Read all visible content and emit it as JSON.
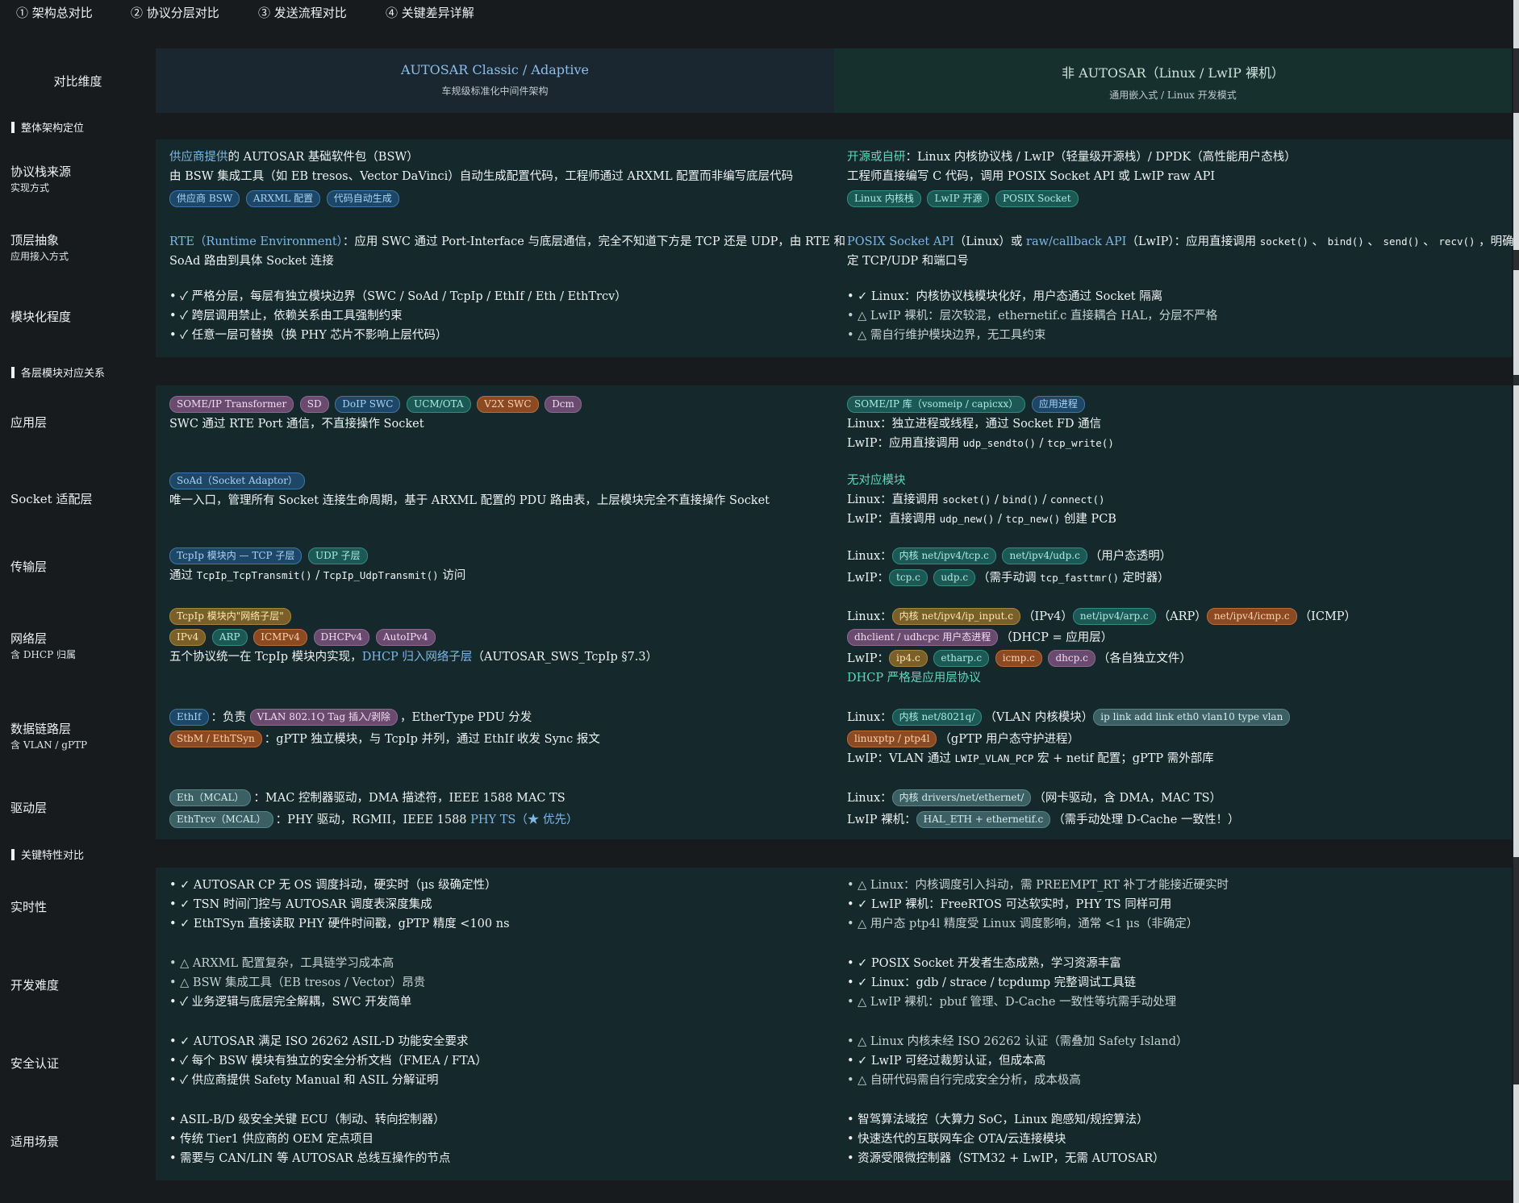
{
  "tabs": [
    "① 架构总对比",
    "② 协议分层对比",
    "③ 发送流程对比",
    "④ 关键差异详解"
  ],
  "header": {
    "dim_label": "对比维度",
    "colA_title": "AUTOSAR Classic / Adaptive",
    "colA_sub": "车规级标准化中间件架构",
    "colB_title": "非 AUTOSAR（Linux / LwIP 裸机）",
    "colB_sub": "通用嵌入式 / Linux 开发模式"
  },
  "sections": {
    "s1": "整体架构定位",
    "s2": "各层模块对应关系",
    "s3": "关键特性对比"
  },
  "rows": {
    "stack": {
      "label": "协议栈来源",
      "sub": "实现方式",
      "a_hl": "供应商提供",
      "a1_rest": "的 AUTOSAR 基础软件包（BSW）",
      "a2": "由 BSW 集成工具（如 EB tresos、Vector DaVinci）自动生成配置代码，工程师通过 ARXML 配置而非编写底层代码",
      "a_tags": [
        "供应商 BSW",
        "ARXML 配置",
        "代码自动生成"
      ],
      "b_hl": "开源或自研",
      "b1_rest": "：Linux 内核协议栈 / LwIP（轻量级开源栈）/ DPDK（高性能用户态栈）",
      "b2": "工程师直接编写 C 代码，调用 POSIX Socket API 或 LwIP raw API",
      "b_tags": [
        "Linux 内核栈",
        "LwIP 开源",
        "POSIX Socket"
      ]
    },
    "abstract": {
      "label": "顶层抽象",
      "sub": "应用接入方式",
      "a_hl": "RTE（Runtime Environment）",
      "a1_rest": "：应用 SWC 通过 Port-Interface 与底层通信，完全不知道下方是 TCP 还是 UDP，由 RTE 和",
      "a2": "SoAd 路由到具体 Socket 连接",
      "b_hl1": "POSIX Socket API",
      "b_m1": "（Linux）或 ",
      "b_hl2": "raw/callback API",
      "b_m2": "（LwIP）：应用直接调用 ",
      "b_c1": "socket()",
      "b_c2": "bind()",
      "b_c3": "send()",
      "b_c4": "recv()",
      "b_sep": " 、 ",
      "b_m3": " ，明确指",
      "b2": "定 TCP/UDP 和端口号"
    },
    "modular": {
      "label": "模块化程度",
      "a": [
        "✓ 严格分层，每层有独立模块边界（SWC / SoAd / TcpIp / EthIf / Eth / EthTrcv）",
        "✓ 跨层调用禁止，依赖关系由工具强制约束",
        "✓ 任意一层可替换（换 PHY 芯片不影响上层代码）"
      ],
      "b": [
        "✓ Linux：内核协议栈模块化好，用户态通过 Socket 隔离",
        "△ LwIP 裸机：层次较混，ethernetif.c 直接耦合 HAL，分层不严格",
        "△ 需自行维护模块边界，无工具约束"
      ]
    },
    "app": {
      "label": "应用层",
      "a_tags": [
        "SOME/IP Transformer",
        "SD",
        "DoIP SWC",
        "UCM/OTA",
        "V2X SWC",
        "Dcm"
      ],
      "a1": "SWC 通过 RTE Port 通信，不直接操作 Socket",
      "b_tags": [
        "SOME/IP 库（vsomeip / capicxx）",
        "应用进程"
      ],
      "b1": "Linux：独立进程或线程，通过 Socket FD 通信",
      "b2_pre": "LwIP：应用直接调用 ",
      "b2_c1": "udp_sendto()",
      "b2_sep": " / ",
      "b2_c2": "tcp_write()"
    },
    "socket": {
      "label": "Socket 适配层",
      "a_tag": "SoAd（Socket Adaptor）",
      "a1": "唯一入口，管理所有 Socket 连接生命周期，基于 ARXML 配置的 PDU 路由表，上层模块完全不直接操作 Socket",
      "b_hl": "无对应模块",
      "b1_pre": "Linux：直接调用 ",
      "b1_c1": "socket()",
      "b1_c2": "bind()",
      "b1_c3": "connect()",
      "b_sep": " / ",
      "b2_pre": "LwIP：直接调用 ",
      "b2_c1": "udp_new()",
      "b2_c2": "tcp_new()",
      "b2_post": " 创建 PCB"
    },
    "transport": {
      "label": "传输层",
      "a_tags": [
        "TcpIp 模块内 — TCP 子层",
        "UDP 子层"
      ],
      "a1_pre": "通过 ",
      "a1_c1": "TcpIp_TcpTransmit()",
      "a1_sep": " / ",
      "a1_c2": "TcpIp_UdpTransmit()",
      "a1_post": " 访问",
      "b1_pre": "Linux：",
      "b1_tags": [
        "内核 net/ipv4/tcp.c",
        "net/ipv4/udp.c"
      ],
      "b1_post": "（用户态透明）",
      "b2_pre": "LwIP：",
      "b2_tags": [
        "tcp.c",
        "udp.c"
      ],
      "b2_mid": "（需手动调 ",
      "b2_c": "tcp_fasttmr()",
      "b2_post": " 定时器）"
    },
    "network": {
      "label": "网络层",
      "sub": "含 DHCP 归属",
      "a_tag_top": "TcpIp 模块内\"网络子层\"",
      "a_tags": [
        "IPv4",
        "ARP",
        "ICMPv4",
        "DHCPv4",
        "AutoIPv4"
      ],
      "a1_pre": "五个协议统一在 TcpIp 模块内实现，",
      "a1_hl": "DHCP 归入网络子层",
      "a1_post": "（AUTOSAR_SWS_TcpIp §7.3）",
      "b1_pre": "Linux：",
      "b1_t1": "内核 net/ipv4/ip_input.c",
      "b1_m1": "（IPv4）",
      "b1_t2": "net/ipv4/arp.c",
      "b1_m2": "（ARP）",
      "b1_t3": "net/ipv4/icmp.c",
      "b1_m3": "（ICMP）",
      "b2_tag": "dhclient / udhcpc 用户态进程",
      "b2_post": "（DHCP = 应用层）",
      "b3_pre": "LwIP：",
      "b3_tags": [
        "ip4.c",
        "etharp.c",
        "icmp.c",
        "dhcp.c"
      ],
      "b3_post": "（各自独立文件）",
      "b4_hl": "DHCP 严格是应用层协议"
    },
    "datalink": {
      "label": "数据链路层",
      "sub": "含 VLAN / gPTP",
      "a1_tag": "EthIf",
      "a1_mid": "：负责 ",
      "a1_tag2": "VLAN 802.1Q Tag 插入/剥除",
      "a1_post": "，EtherType PDU 分发",
      "a2_tag": "StbM / EthTSyn",
      "a2_post": "：gPTP 独立模块，与 TcpIp 并列，通过 EthIf 收发 Sync 报文",
      "b1_pre": "Linux：",
      "b1_tag": "内核 net/8021q/",
      "b1_mid": "（VLAN 内核模块）",
      "b1_tag2": "ip link add link eth0 vlan10 type vlan",
      "b2_tag": "linuxptp / ptp4l",
      "b2_post": "（gPTP 用户态守护进程）",
      "b3_pre": "LwIP：VLAN 通过 ",
      "b3_c": "LWIP_VLAN_PCP",
      "b3_post": " 宏 + netif 配置；gPTP 需外部库"
    },
    "driver": {
      "label": "驱动层",
      "a1_tag": "Eth（MCAL）",
      "a1_post": "：MAC 控制器驱动，DMA 描述符，IEEE 1588 MAC TS",
      "a2_tag": "EthTrcv（MCAL）",
      "a2_mid": "：PHY 驱动，RGMII，IEEE 1588 ",
      "a2_hl": "PHY TS（★ 优先）",
      "b1_pre": "Linux：",
      "b1_tag": "内核 drivers/net/ethernet/",
      "b1_post": "（网卡驱动，含 DMA，MAC TS）",
      "b2_pre": "LwIP 裸机：",
      "b2_tag": "HAL_ETH + ethernetif.c",
      "b2_post": "（需手动处理 D-Cache 一致性！）"
    },
    "realtime": {
      "label": "实时性",
      "a": [
        "✓ AUTOSAR CP 无 OS 调度抖动，硬实时（μs 级确定性）",
        "✓ TSN 时间门控与 AUTOSAR 调度表深度集成",
        "✓ EthTSyn 直接读取 PHY 硬件时间戳，gPTP 精度 <100 ns"
      ],
      "b": [
        "△ Linux：内核调度引入抖动，需 PREEMPT_RT 补丁才能接近硬实时",
        "✓ LwIP 裸机：FreeRTOS 可达软实时，PHY TS 同样可用",
        "△ 用户态 ptp4l 精度受 Linux 调度影响，通常 <1 μs（非确定）"
      ]
    },
    "difficulty": {
      "label": "开发难度",
      "a": [
        "△ ARXML 配置复杂，工具链学习成本高",
        "△ BSW 集成工具（EB tresos / Vector）昂贵",
        "✓ 业务逻辑与底层完全解耦，SWC 开发简单"
      ],
      "b": [
        "✓ POSIX Socket 开发者生态成熟，学习资源丰富",
        "✓ Linux：gdb / strace / tcpdump 完整调试工具链",
        "△ LwIP 裸机：pbuf 管理、D-Cache 一致性等坑需手动处理"
      ]
    },
    "safety": {
      "label": "安全认证",
      "a": [
        "✓ AUTOSAR 满足 ISO 26262 ASIL-D 功能安全要求",
        "✓ 每个 BSW 模块有独立的安全分析文档（FMEA / FTA）",
        "✓ 供应商提供 Safety Manual 和 ASIL 分解证明"
      ],
      "b": [
        "△ Linux 内核未经 ISO 26262 认证（需叠加 Safety Island）",
        "✓ LwIP 可经过裁剪认证，但成本高",
        "△ 自研代码需自行完成安全分析，成本极高"
      ]
    },
    "scenario": {
      "label": "适用场景",
      "a": [
        "ASIL-B/D 级安全关键 ECU（制动、转向控制器）",
        "传统 Tier1 供应商的 OEM 定点项目",
        "需要与 CAN/LIN 等 AUTOSAR 总线互操作的节点"
      ],
      "b": [
        "智驾算法域控（大算力 SoC，Linux 跑感知/规控算法）",
        "快速迭代的互联网车企 OTA/云连接模块",
        "资源受限微控制器（STM32 + LwIP，无需 AUTOSAR）"
      ]
    }
  }
}
